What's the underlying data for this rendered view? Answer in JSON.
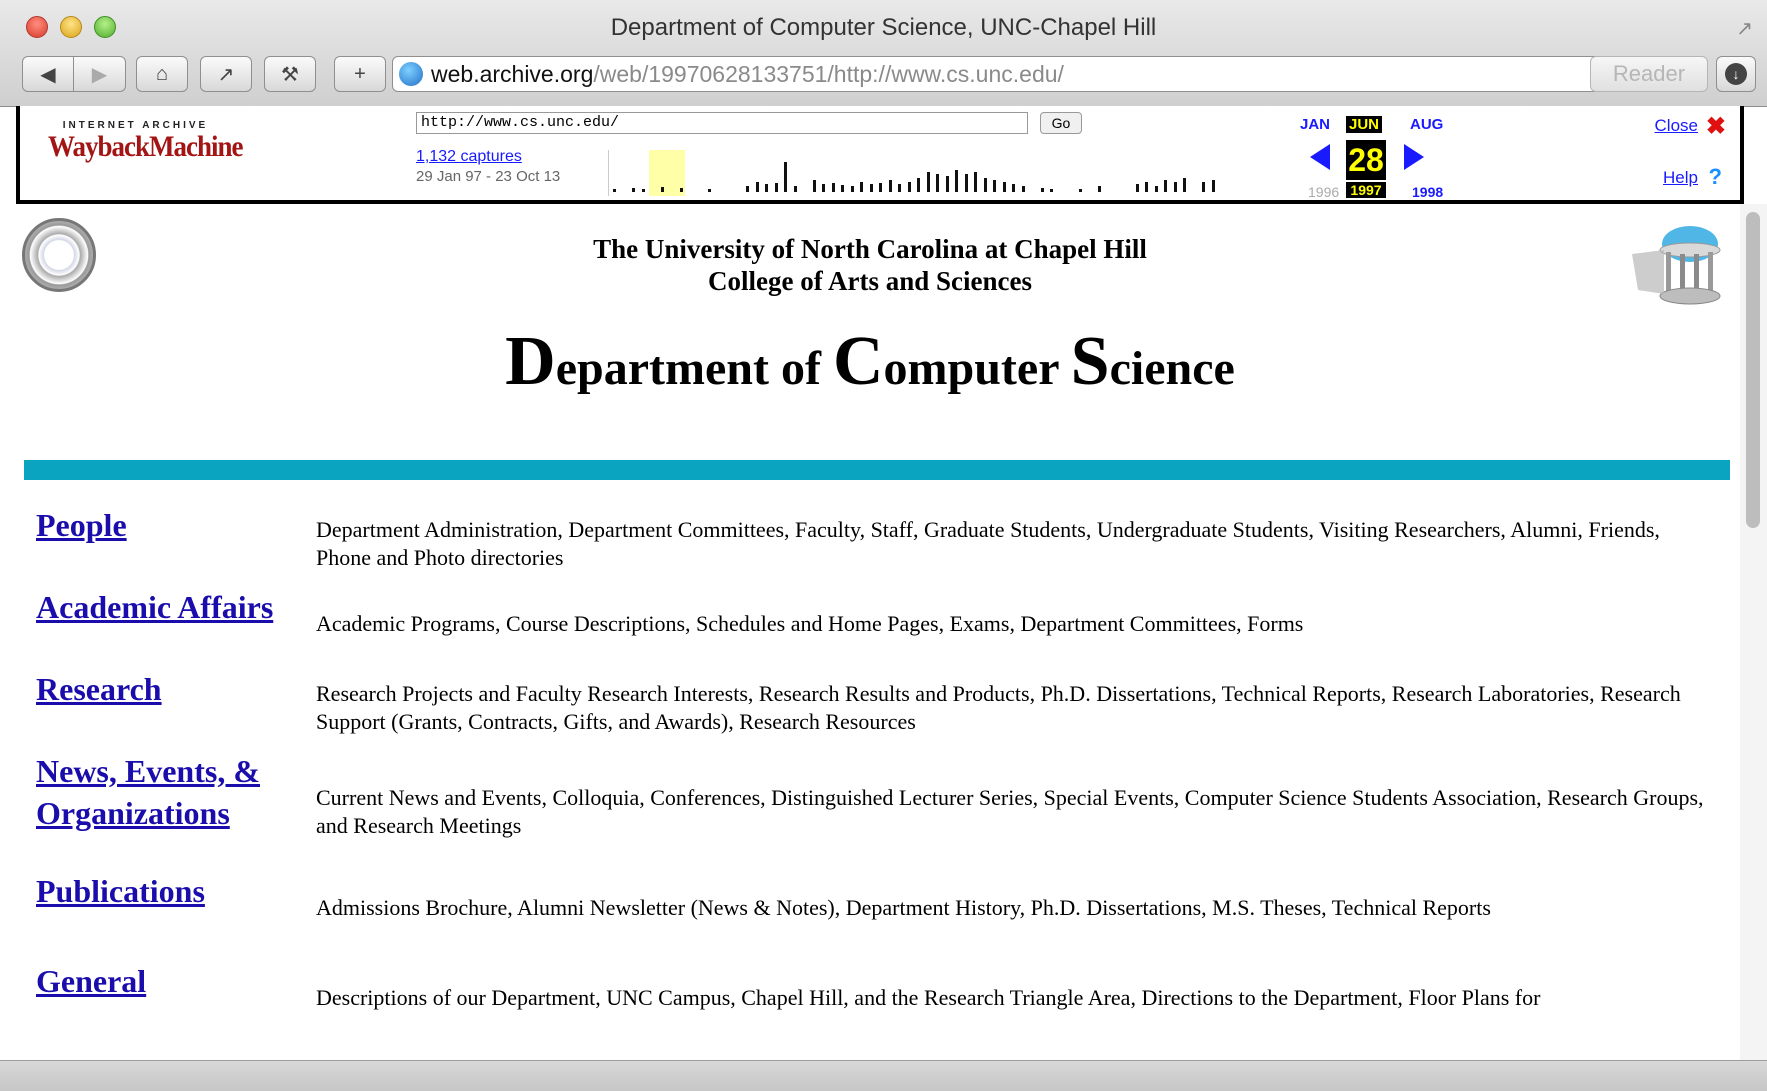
{
  "window": {
    "title": "Department of Computer Science, UNC-Chapel Hill",
    "address_host": "web.archive.org",
    "address_rest": "/web/19970628133751/http://www.cs.unc.edu/",
    "reader_label": "Reader"
  },
  "wayback": {
    "logo_top": "INTERNET ARCHIVE",
    "logo_main": "WaybackMachine",
    "url_value": "http://www.cs.unc.edu/",
    "go_label": "Go",
    "captures": "1,132 captures",
    "range": "29 Jan 97 - 23 Oct 13",
    "month_prev": "JAN",
    "month_cur": "JUN",
    "month_next": "AUG",
    "day": "28",
    "year_prev": "1996",
    "year_cur": "1997",
    "year_next": "1998",
    "close_label": "Close",
    "help_label": "Help"
  },
  "header": {
    "university": "The University of North Carolina at Chapel Hill",
    "college": "College of Arts and Sciences",
    "dept_D": "D",
    "dept_1": "epartment of ",
    "dept_C": "C",
    "dept_2": "omputer ",
    "dept_S": "S",
    "dept_3": "cience"
  },
  "sections": [
    {
      "title": "People",
      "desc": "Department Administration, Department Committees, Faculty, Staff, Graduate Students, Undergraduate Students, Visiting Researchers, Alumni, Friends, Phone and Photo directories"
    },
    {
      "title": "Academic Affairs",
      "desc": "Academic Programs, Course Descriptions, Schedules and Home Pages, Exams, Department Committees, Forms"
    },
    {
      "title": "Research",
      "desc": "Research Projects and Faculty Research Interests, Research Results and Products, Ph.D. Dissertations, Technical Reports, Research Laboratories, Research Support (Grants, Contracts, Gifts, and Awards), Research Resources"
    },
    {
      "title_1": "News, Events, &",
      "title_2": "Organizations",
      "desc": "Current News and Events, Colloquia, Conferences, Distinguished Lecturer Series, Special Events, Computer Science Students Association, Research Groups, and Research Meetings"
    },
    {
      "title": "Publications",
      "desc": "Admissions Brochure, Alumni Newsletter (News & Notes), Department History, Ph.D. Dissertations, M.S. Theses, Technical Reports"
    },
    {
      "title": "General",
      "desc": "Descriptions of our Department, UNC Campus, Chapel Hill, and the Research Triangle Area, Directions to the Department, Floor Plans for"
    }
  ],
  "colors": {
    "accent_rule": "#0aa4c0",
    "link": "#1a0dab",
    "wayback_highlight": "#ffff00"
  },
  "icons": [
    "back-icon",
    "forward-icon",
    "home-icon",
    "share-icon",
    "tools-icon",
    "add-icon",
    "globe-icon",
    "reload-icon",
    "download-icon",
    "close-icon",
    "help-icon",
    "seal-icon",
    "old-well-icon"
  ]
}
